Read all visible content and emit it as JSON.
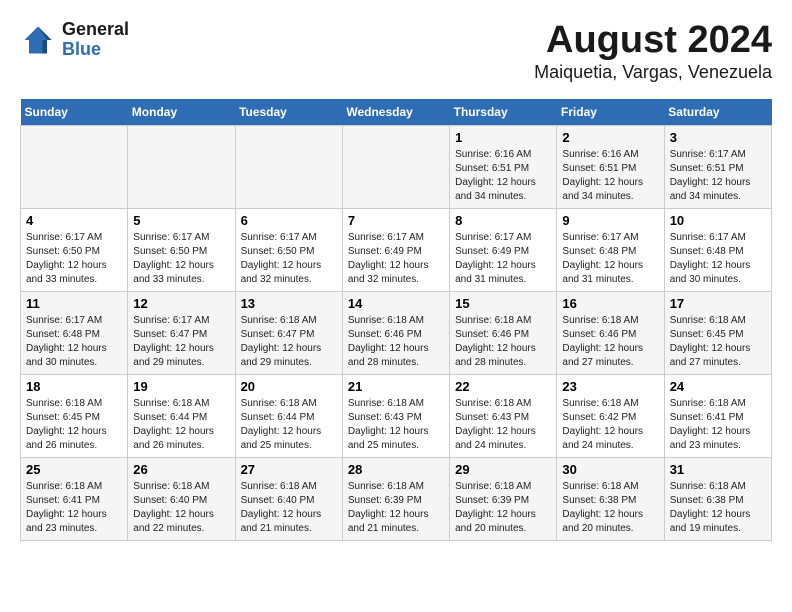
{
  "logo": {
    "text_general": "General",
    "text_blue": "Blue"
  },
  "title": "August 2024",
  "subtitle": "Maiquetia, Vargas, Venezuela",
  "days_of_week": [
    "Sunday",
    "Monday",
    "Tuesday",
    "Wednesday",
    "Thursday",
    "Friday",
    "Saturday"
  ],
  "weeks": [
    [
      {
        "day": "",
        "info": ""
      },
      {
        "day": "",
        "info": ""
      },
      {
        "day": "",
        "info": ""
      },
      {
        "day": "",
        "info": ""
      },
      {
        "day": "1",
        "info": "Sunrise: 6:16 AM\nSunset: 6:51 PM\nDaylight: 12 hours\nand 34 minutes."
      },
      {
        "day": "2",
        "info": "Sunrise: 6:16 AM\nSunset: 6:51 PM\nDaylight: 12 hours\nand 34 minutes."
      },
      {
        "day": "3",
        "info": "Sunrise: 6:17 AM\nSunset: 6:51 PM\nDaylight: 12 hours\nand 34 minutes."
      }
    ],
    [
      {
        "day": "4",
        "info": "Sunrise: 6:17 AM\nSunset: 6:50 PM\nDaylight: 12 hours\nand 33 minutes."
      },
      {
        "day": "5",
        "info": "Sunrise: 6:17 AM\nSunset: 6:50 PM\nDaylight: 12 hours\nand 33 minutes."
      },
      {
        "day": "6",
        "info": "Sunrise: 6:17 AM\nSunset: 6:50 PM\nDaylight: 12 hours\nand 32 minutes."
      },
      {
        "day": "7",
        "info": "Sunrise: 6:17 AM\nSunset: 6:49 PM\nDaylight: 12 hours\nand 32 minutes."
      },
      {
        "day": "8",
        "info": "Sunrise: 6:17 AM\nSunset: 6:49 PM\nDaylight: 12 hours\nand 31 minutes."
      },
      {
        "day": "9",
        "info": "Sunrise: 6:17 AM\nSunset: 6:48 PM\nDaylight: 12 hours\nand 31 minutes."
      },
      {
        "day": "10",
        "info": "Sunrise: 6:17 AM\nSunset: 6:48 PM\nDaylight: 12 hours\nand 30 minutes."
      }
    ],
    [
      {
        "day": "11",
        "info": "Sunrise: 6:17 AM\nSunset: 6:48 PM\nDaylight: 12 hours\nand 30 minutes."
      },
      {
        "day": "12",
        "info": "Sunrise: 6:17 AM\nSunset: 6:47 PM\nDaylight: 12 hours\nand 29 minutes."
      },
      {
        "day": "13",
        "info": "Sunrise: 6:18 AM\nSunset: 6:47 PM\nDaylight: 12 hours\nand 29 minutes."
      },
      {
        "day": "14",
        "info": "Sunrise: 6:18 AM\nSunset: 6:46 PM\nDaylight: 12 hours\nand 28 minutes."
      },
      {
        "day": "15",
        "info": "Sunrise: 6:18 AM\nSunset: 6:46 PM\nDaylight: 12 hours\nand 28 minutes."
      },
      {
        "day": "16",
        "info": "Sunrise: 6:18 AM\nSunset: 6:46 PM\nDaylight: 12 hours\nand 27 minutes."
      },
      {
        "day": "17",
        "info": "Sunrise: 6:18 AM\nSunset: 6:45 PM\nDaylight: 12 hours\nand 27 minutes."
      }
    ],
    [
      {
        "day": "18",
        "info": "Sunrise: 6:18 AM\nSunset: 6:45 PM\nDaylight: 12 hours\nand 26 minutes."
      },
      {
        "day": "19",
        "info": "Sunrise: 6:18 AM\nSunset: 6:44 PM\nDaylight: 12 hours\nand 26 minutes."
      },
      {
        "day": "20",
        "info": "Sunrise: 6:18 AM\nSunset: 6:44 PM\nDaylight: 12 hours\nand 25 minutes."
      },
      {
        "day": "21",
        "info": "Sunrise: 6:18 AM\nSunset: 6:43 PM\nDaylight: 12 hours\nand 25 minutes."
      },
      {
        "day": "22",
        "info": "Sunrise: 6:18 AM\nSunset: 6:43 PM\nDaylight: 12 hours\nand 24 minutes."
      },
      {
        "day": "23",
        "info": "Sunrise: 6:18 AM\nSunset: 6:42 PM\nDaylight: 12 hours\nand 24 minutes."
      },
      {
        "day": "24",
        "info": "Sunrise: 6:18 AM\nSunset: 6:41 PM\nDaylight: 12 hours\nand 23 minutes."
      }
    ],
    [
      {
        "day": "25",
        "info": "Sunrise: 6:18 AM\nSunset: 6:41 PM\nDaylight: 12 hours\nand 23 minutes."
      },
      {
        "day": "26",
        "info": "Sunrise: 6:18 AM\nSunset: 6:40 PM\nDaylight: 12 hours\nand 22 minutes."
      },
      {
        "day": "27",
        "info": "Sunrise: 6:18 AM\nSunset: 6:40 PM\nDaylight: 12 hours\nand 21 minutes."
      },
      {
        "day": "28",
        "info": "Sunrise: 6:18 AM\nSunset: 6:39 PM\nDaylight: 12 hours\nand 21 minutes."
      },
      {
        "day": "29",
        "info": "Sunrise: 6:18 AM\nSunset: 6:39 PM\nDaylight: 12 hours\nand 20 minutes."
      },
      {
        "day": "30",
        "info": "Sunrise: 6:18 AM\nSunset: 6:38 PM\nDaylight: 12 hours\nand 20 minutes."
      },
      {
        "day": "31",
        "info": "Sunrise: 6:18 AM\nSunset: 6:38 PM\nDaylight: 12 hours\nand 19 minutes."
      }
    ]
  ]
}
